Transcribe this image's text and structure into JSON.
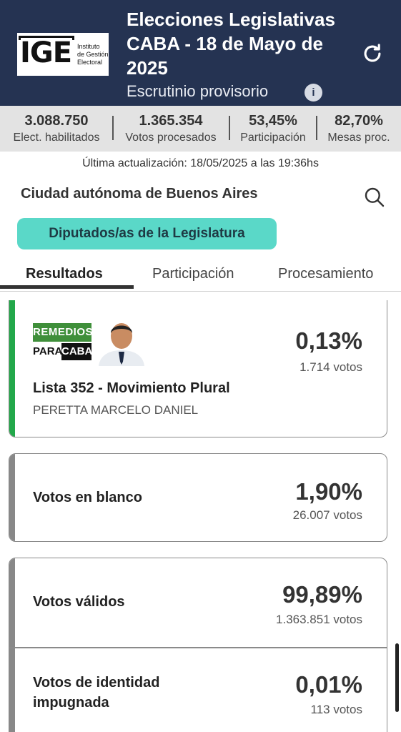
{
  "header": {
    "title": "Elecciones Legislativas CABA - 18 de Mayo de 2025",
    "subtitle": "Escrutinio provisorio",
    "logo_text": "IGE",
    "logo_sub": [
      "Instituto",
      "de Gestión",
      "Electoral"
    ],
    "info_icon": "i",
    "refresh_icon": "refresh-icon",
    "bg_color": "#253352"
  },
  "stats": [
    {
      "value": "3.088.750",
      "label": "Elect. habilitados"
    },
    {
      "value": "1.365.354",
      "label": "Votos procesados"
    },
    {
      "value": "53,45%",
      "label": "Participación"
    },
    {
      "value": "82,70%",
      "label": "Mesas proc."
    }
  ],
  "updated": "Última actualización: 18/05/2025 a las 19:36hs",
  "region": "Ciudad autónoma de Buenos Aires",
  "category_chip": "Diputados/as de la Legislatura",
  "chip_color": "#5ad8c8",
  "tabs": [
    {
      "label": "Resultados",
      "active": true
    },
    {
      "label": "Participación",
      "active": false
    },
    {
      "label": "Procesamiento",
      "active": false
    }
  ],
  "results": {
    "party": {
      "logo_top": "REMEDIOS",
      "logo_left": "PARA",
      "logo_right": "CABA",
      "list": "Lista 352 - Movimiento Plural",
      "candidate": "PERETTA MARCELO DANIEL",
      "pct": "0,13%",
      "votes": "1.714 votos",
      "color": "#22a84a"
    },
    "blank": {
      "label": "Votos en blanco",
      "pct": "1,90%",
      "votes": "26.007 votos"
    },
    "valid": {
      "label": "Votos válidos",
      "pct": "99,89%",
      "votes": "1.363.851 votos"
    },
    "impugned": {
      "label": "Votos de identidad impugnada",
      "pct": "0,01%",
      "votes": "113 votos"
    }
  }
}
